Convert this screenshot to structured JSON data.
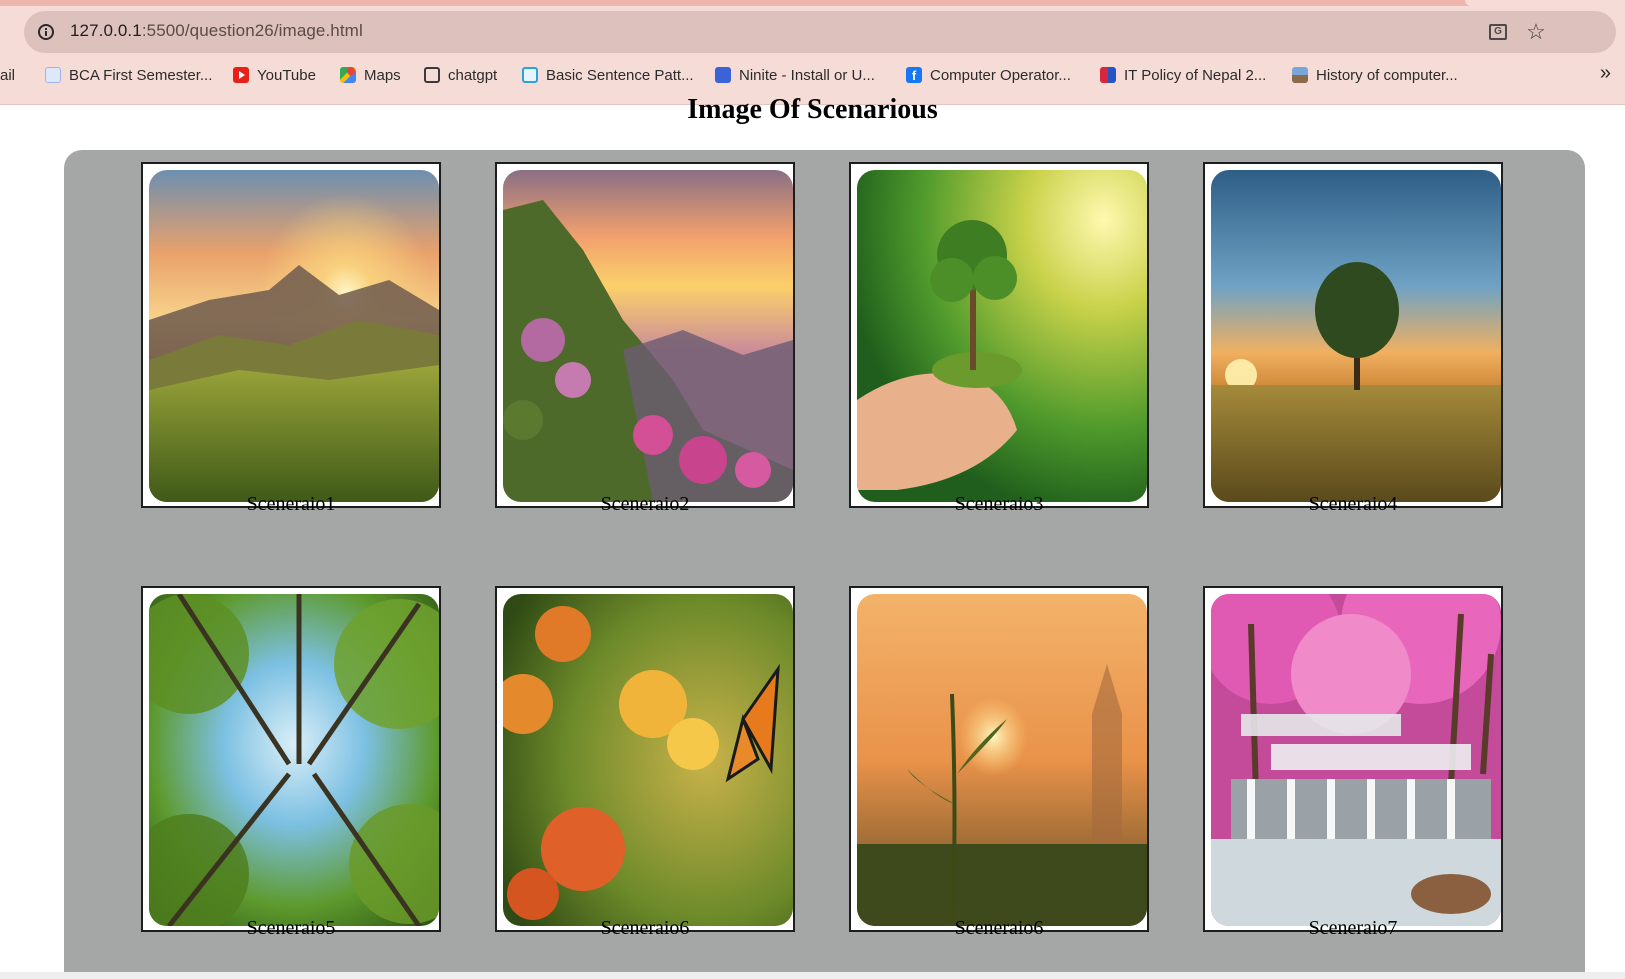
{
  "browser": {
    "url_host": "127.0.0.1",
    "url_path": ":5500/question26/image.html",
    "bookmarks": [
      {
        "label": "ail",
        "icon": "mail-fragment"
      },
      {
        "label": "BCA First Semester...",
        "icon": "bca-icon"
      },
      {
        "label": "YouTube",
        "icon": "youtube-icon"
      },
      {
        "label": "Maps",
        "icon": "maps-icon"
      },
      {
        "label": "chatgpt",
        "icon": "chatgpt-icon"
      },
      {
        "label": "Basic Sentence Patt...",
        "icon": "basic-sentence-icon"
      },
      {
        "label": "Ninite - Install or U...",
        "icon": "ninite-icon"
      },
      {
        "label": "Computer Operator...",
        "icon": "facebook-icon"
      },
      {
        "label": "IT Policy of Nepal 2...",
        "icon": "it-policy-icon"
      },
      {
        "label": "History of computer...",
        "icon": "history-icon"
      }
    ],
    "more_label": "»"
  },
  "page": {
    "title": "Image Of Scenarious",
    "cards": [
      {
        "caption": "Sceneraio1",
        "image": "mountain sunset meadow"
      },
      {
        "caption": "Sceneraio2",
        "image": "sunset hills with pink flowers"
      },
      {
        "caption": "Sceneraio3",
        "image": "hands holding young tree"
      },
      {
        "caption": "Sceneraio4",
        "image": "lone tree in field at sunset"
      },
      {
        "caption": "Sceneraio5",
        "image": "looking up at forest canopy"
      },
      {
        "caption": "Sceneraio6",
        "image": "butterfly on lantana flowers"
      },
      {
        "caption": "Sceneraio6",
        "image": "sprout at golden sunset"
      },
      {
        "caption": "Sceneraio7",
        "image": "pink forest waterfall"
      }
    ]
  },
  "colors": {
    "gallery_bg": "#a4a7a6",
    "chrome_bg": "#f6dcd7",
    "omnibox_bg": "#dcc1bc"
  }
}
